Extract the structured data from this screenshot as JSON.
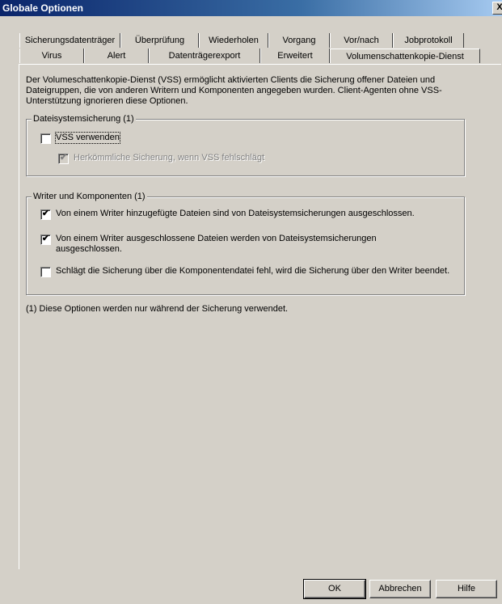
{
  "window": {
    "title": "Globale Optionen",
    "close_glyph": "X"
  },
  "tabs": {
    "row1": [
      "Sicherungsdatenträger",
      "Überprüfung",
      "Wiederholen",
      "Vorgang",
      "Vor/nach",
      "Jobprotokoll"
    ],
    "row2": [
      "Virus",
      "Alert",
      "Datenträgerexport",
      "Erweitert",
      "Volumenschattenkopie-Dienst"
    ],
    "active": "Volumenschattenkopie-Dienst"
  },
  "description": "Der Volumeschattenkopie-Dienst (VSS) ermöglicht aktivierten Clients die Sicherung offener Dateien und Dateigruppen, die von anderen Writern und Komponenten angegeben wurden. Client-Agenten ohne VSS-Unterstützung ignorieren diese Optionen.",
  "group_filesystem": {
    "legend": "Dateisystemsicherung (1)",
    "vss_checkbox": {
      "label": "VSS verwenden",
      "checked": false
    },
    "fallback_checkbox": {
      "label": "Herkömmliche Sicherung, wenn VSS fehlschlägt",
      "checked": true,
      "disabled": true
    }
  },
  "group_writer": {
    "legend": "Writer und Komponenten (1)",
    "option1": {
      "label": "Von einem Writer hinzugefügte Dateien sind von Dateisystemsicherungen ausgeschlossen.",
      "checked": true
    },
    "option2": {
      "label": "Von einem Writer ausgeschlossene Dateien werden von Dateisystemsicherungen ausgeschlossen.",
      "checked": true
    },
    "option3": {
      "label": "Schlägt die Sicherung über die Komponentendatei fehl, wird die Sicherung über den Writer beendet.",
      "checked": false
    }
  },
  "footnote": "(1) Diese Optionen werden nur während der Sicherung verwendet.",
  "buttons": {
    "ok": "OK",
    "cancel": "Abbrechen",
    "help": "Hilfe"
  },
  "checkmark_glyph": "✔"
}
